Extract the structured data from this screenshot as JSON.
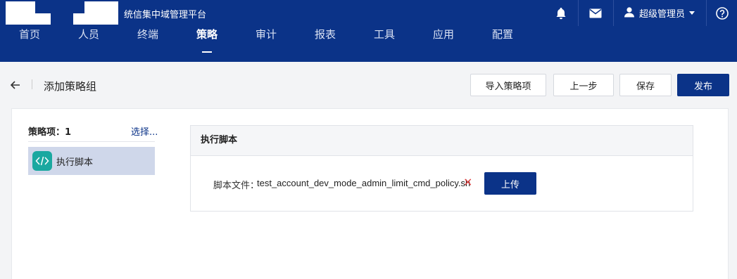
{
  "header": {
    "platform_title": "统信集中域管理平台",
    "user_name": "超级管理员",
    "icons": [
      "bell-icon",
      "mail-icon",
      "user-icon",
      "caret-down-icon",
      "help-icon"
    ]
  },
  "nav": {
    "items": [
      {
        "label": "首页"
      },
      {
        "label": "人员"
      },
      {
        "label": "终端"
      },
      {
        "label": "策略"
      },
      {
        "label": "审计"
      },
      {
        "label": "报表"
      },
      {
        "label": "工具"
      },
      {
        "label": "应用"
      },
      {
        "label": "配置"
      }
    ],
    "active": "策略"
  },
  "page": {
    "title": "添加策略组",
    "buttons": {
      "import": "导入策略项",
      "prev": "上一步",
      "save": "保存",
      "publish": "发布"
    }
  },
  "sidebar": {
    "items_label": "策略项：",
    "items_count": "1",
    "select_link": "选择...",
    "items": [
      {
        "label": "执行脚本",
        "icon": "code-icon"
      }
    ]
  },
  "panel": {
    "title": "执行脚本",
    "file_label": "脚本文件：",
    "file_name": "test_account_dev_mode_admin_limit_cmd_policy.sh",
    "remove_symbol": "×",
    "upload_label": "上传"
  },
  "colors": {
    "brand": "#0b3388",
    "accent_teal": "#1aa8a0",
    "danger": "#e23b3b",
    "selected_bg": "#cfd7ea"
  }
}
